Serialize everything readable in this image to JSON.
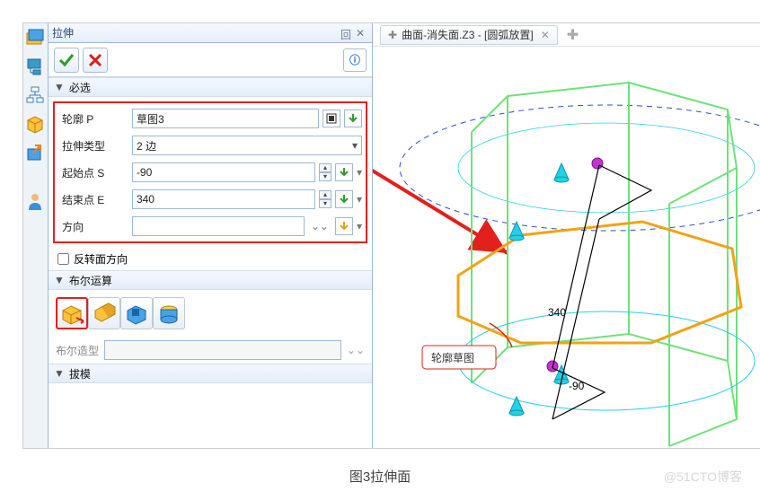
{
  "panel": {
    "title": "拉伸"
  },
  "sections": {
    "required": "必选",
    "boolean": "布尔运算",
    "draft": "拔模"
  },
  "fields": {
    "profile": {
      "label": "轮廓 P",
      "value": "草图3"
    },
    "type": {
      "label": "拉伸类型",
      "value": "2 边"
    },
    "start": {
      "label": "起始点 S",
      "value": "-90"
    },
    "end": {
      "label": "结束点 E",
      "value": "340"
    },
    "direction": {
      "label": "方向",
      "value": ""
    }
  },
  "reverse": {
    "label": "反转面方向"
  },
  "shape": {
    "label": "布尔造型"
  },
  "tab": {
    "label": "曲面-消失面.Z3 - [圆弧放置]"
  },
  "callout": {
    "sketch": "轮廓草图"
  },
  "dims": {
    "len": "340",
    "depth": "-90"
  },
  "caption": "图3拉伸面",
  "watermark": "@51CTO博客",
  "boolean_ops": [
    "base",
    "add",
    "remove",
    "intersect"
  ]
}
